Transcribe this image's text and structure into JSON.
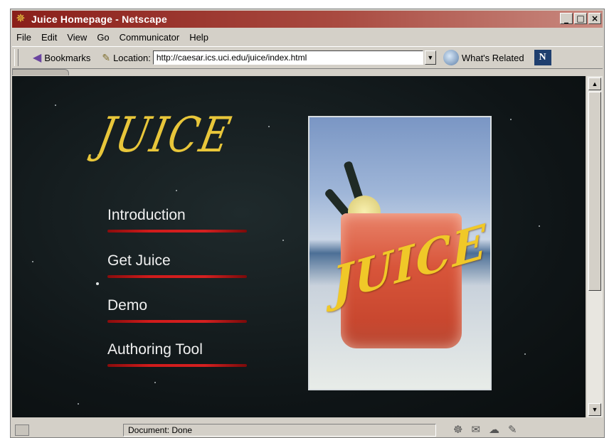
{
  "window": {
    "title": "Juice Homepage - Netscape"
  },
  "menus": [
    "File",
    "Edit",
    "View",
    "Go",
    "Communicator",
    "Help"
  ],
  "toolbar": {
    "bookmarks_label": "Bookmarks",
    "location_label": "Location:",
    "url": "http://caesar.ics.uci.edu/juice/index.html",
    "related_label": "What's Related",
    "netscape_logo": "N"
  },
  "page": {
    "logo": "JUICE",
    "nav": [
      "Introduction",
      "Get Juice",
      "Demo",
      "Authoring Tool"
    ],
    "photo_logo": "JUICE",
    "colors": {
      "logo": "#e8c63a",
      "link_bar": "#d01b1b",
      "background": "#0f1517"
    }
  },
  "status": {
    "text": "Document: Done"
  },
  "icons": {
    "app": "netscape-star-icon",
    "bookmarks": "bookmarks-icon",
    "location": "location-icon",
    "related": "whats-related-icon"
  }
}
